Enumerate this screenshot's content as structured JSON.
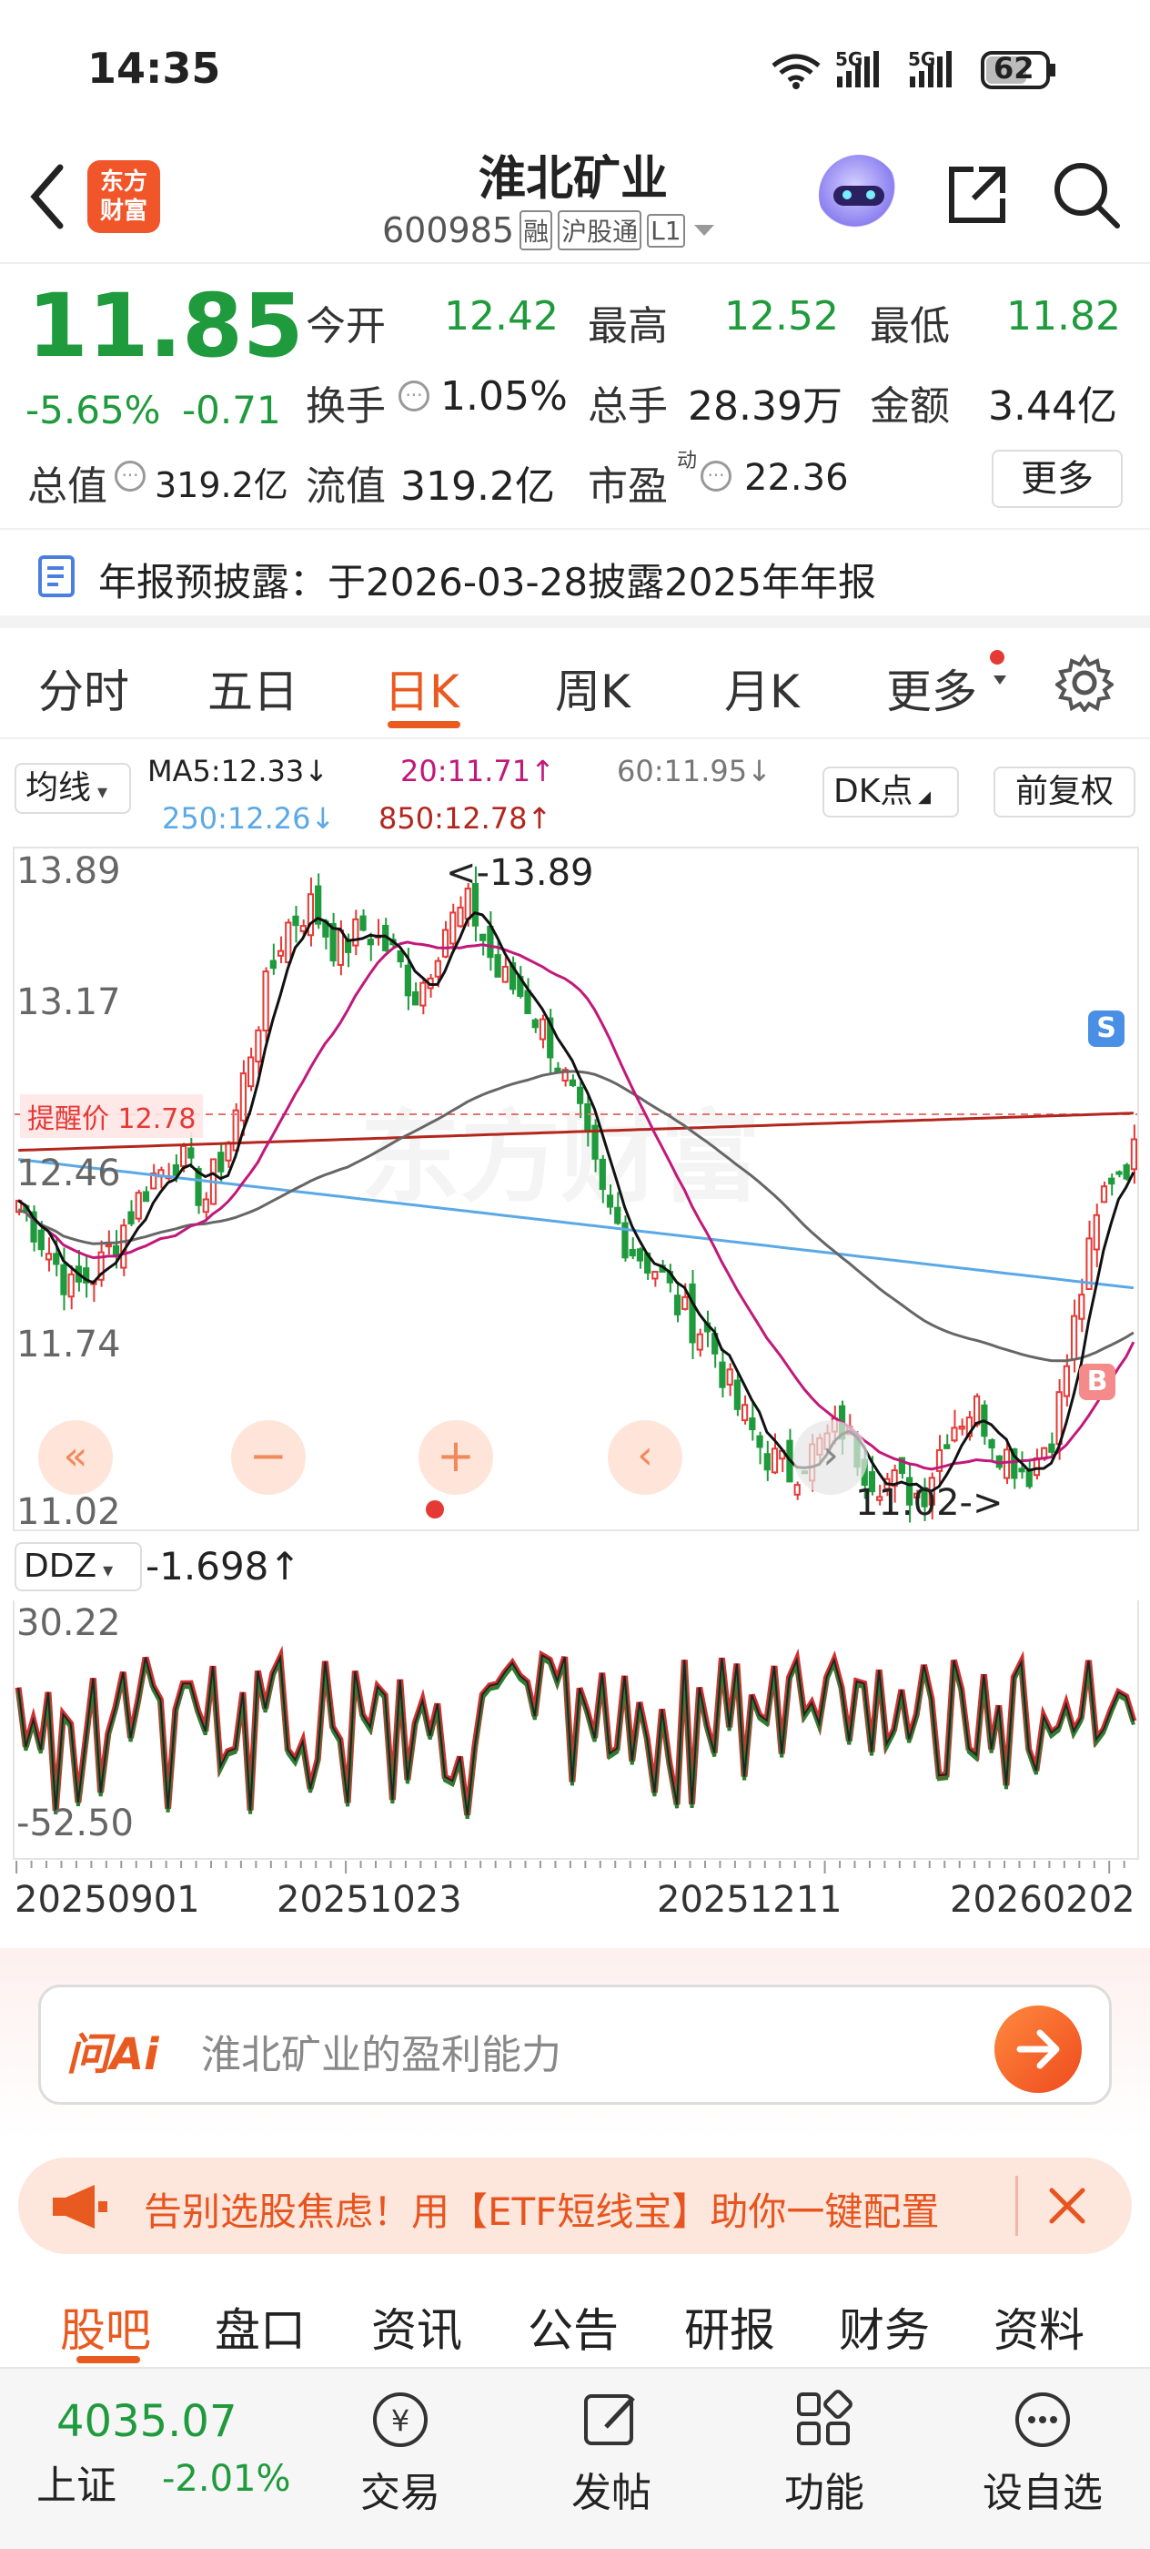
{
  "status": {
    "time": "14:35",
    "signal1": "6",
    "signal2": "5G",
    "signal3": "5G",
    "battery": "62"
  },
  "header": {
    "broker_logo": "东方财富",
    "title": "淮北矿业",
    "code": "600985",
    "badges": [
      "融",
      "沪股通",
      "L1"
    ]
  },
  "quote": {
    "price": "11.85",
    "change_pct": "-5.65%",
    "change": "-0.71",
    "open_label": "今开",
    "open": "12.42",
    "high_label": "最高",
    "high": "12.52",
    "low_label": "最低",
    "low": "11.82",
    "turnover_label": "换手",
    "turnover": "1.05%",
    "volume_label": "总手",
    "volume": "28.39万",
    "amount_label": "金额",
    "amount": "3.44亿",
    "mktcap_label": "总值",
    "mktcap": "319.2亿",
    "float_label": "流值",
    "float": "319.2亿",
    "pe_label": "市盈",
    "pe_sup": "动",
    "pe": "22.36",
    "more": "更多"
  },
  "notice": "年报预披露：于2026-03-28披露2025年年报",
  "tabs": [
    "分时",
    "五日",
    "日K",
    "周K",
    "月K",
    "更多"
  ],
  "active_tab": "日K",
  "ma": {
    "btn": "均线",
    "ma5": "MA5:12.33↓",
    "ma20": "20:11.71↑",
    "ma60": "60:11.95↓",
    "ma250": "250:12.26↓",
    "ma850": "850:12.78↑",
    "dk": "DK点",
    "adjust": "前复权"
  },
  "chart": {
    "y_ticks": [
      "13.89",
      "13.17",
      "12.46",
      "11.74",
      "11.02"
    ],
    "max_label": "<-13.89",
    "min_label": "11.02->",
    "alert_label": "提醒价 12.78",
    "sell_marker": "S",
    "buy_marker": "B",
    "watermark": "东方财富"
  },
  "indicator": {
    "name": "DDZ",
    "value": "-1.698↑",
    "top": "30.22",
    "bottom": "-52.50"
  },
  "dates": [
    "20250901",
    "20251023",
    "20251211",
    "20260202"
  ],
  "ai": {
    "logo": "问Ai",
    "placeholder": "淮北矿业的盈利能力"
  },
  "promo": "告别选股焦虑！用【ETF短线宝】助你一键配置",
  "bottom_tabs": [
    "股吧",
    "盘口",
    "资讯",
    "公告",
    "研报",
    "财务",
    "资料"
  ],
  "footer": {
    "index_value": "4035.07",
    "index_name": "上证",
    "index_change": "-2.01%",
    "trade": "交易",
    "post": "发帖",
    "func": "功能",
    "watch": "设自选"
  },
  "colors": {
    "up": "#e53935",
    "down": "#1f9a3c",
    "accent": "#ff5a1f"
  }
}
